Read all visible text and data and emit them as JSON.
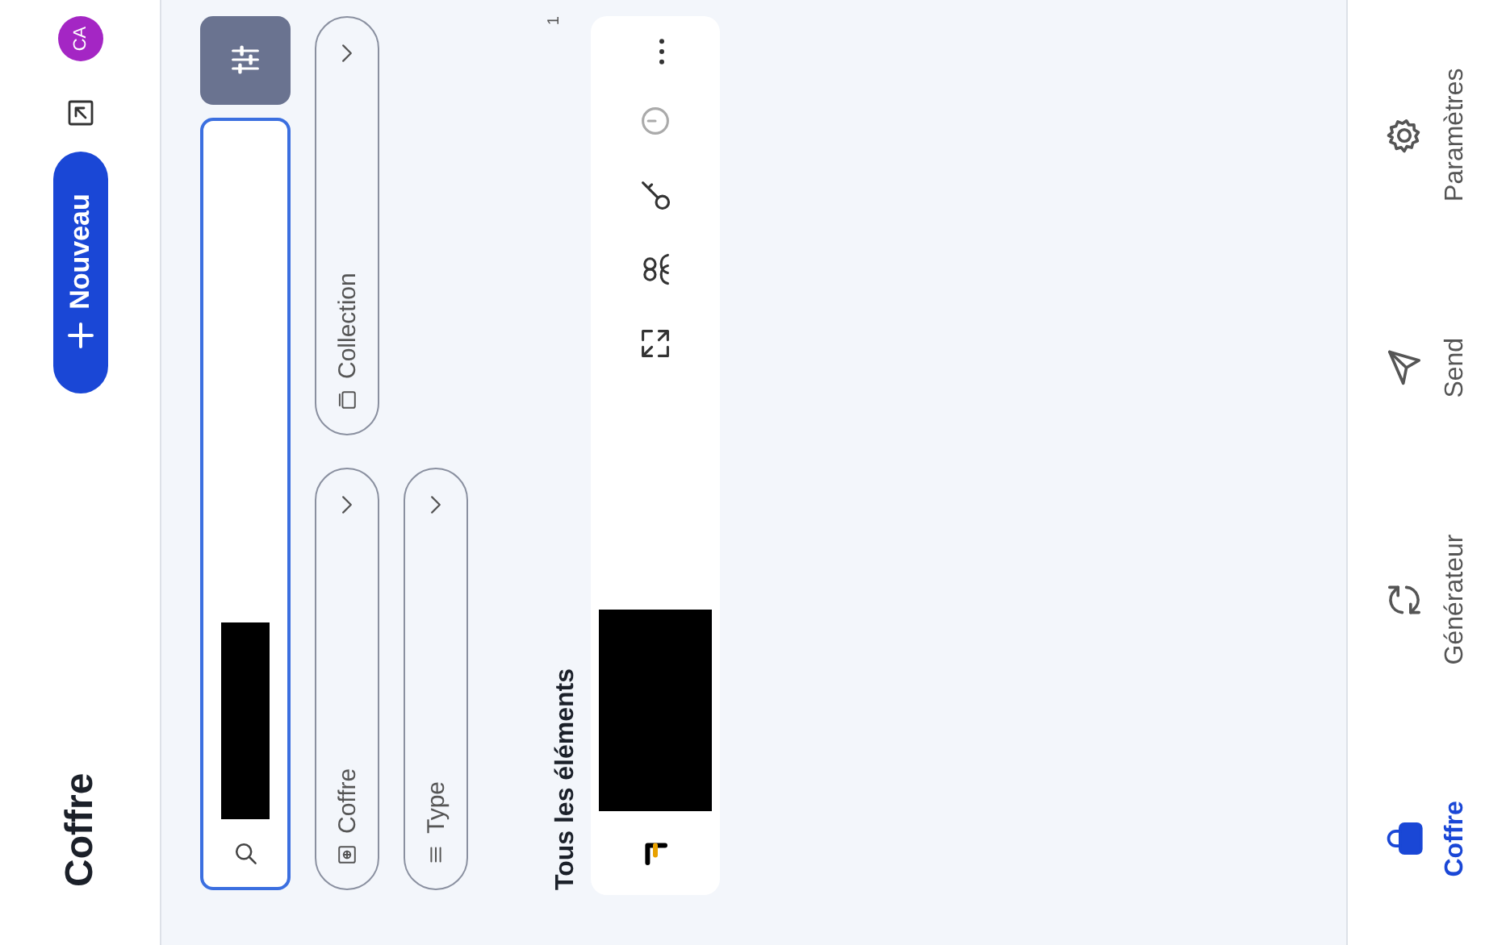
{
  "header": {
    "title": "Coffre",
    "new_button": "Nouveau",
    "avatar": "CA"
  },
  "filters": [
    {
      "label": "Coffre"
    },
    {
      "label": "Collection"
    },
    {
      "label": "Type"
    }
  ],
  "list": {
    "heading": "Tous les éléments",
    "count": "1"
  },
  "nav": [
    {
      "label": "Coffre",
      "selected": true
    },
    {
      "label": "Générateur",
      "selected": false
    },
    {
      "label": "Send",
      "selected": false
    },
    {
      "label": "Paramètres",
      "selected": false
    }
  ]
}
